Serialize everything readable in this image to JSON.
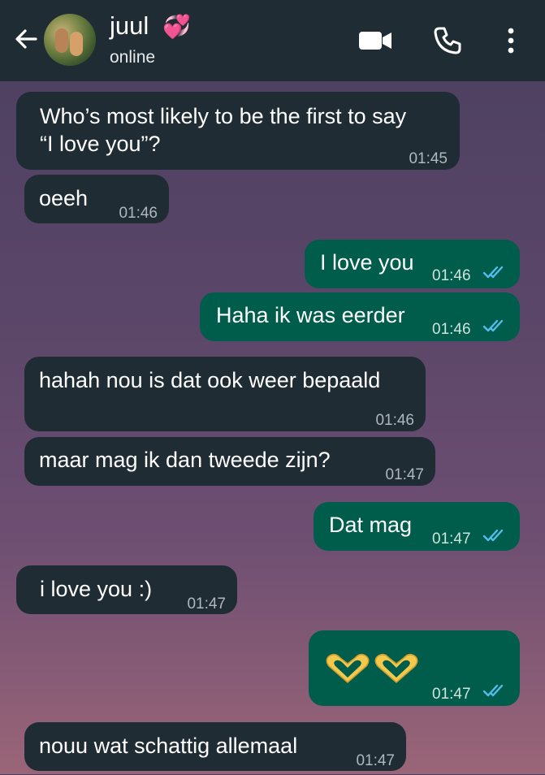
{
  "header": {
    "contact_name": "juul",
    "status": "online"
  },
  "messages": [
    {
      "dir": "in",
      "lines": [
        "Who’s most likely to be the first to say",
        "“I love you”?"
      ],
      "time": "01:45"
    },
    {
      "dir": "in",
      "text": "oeeh",
      "time": "01:46"
    },
    {
      "dir": "out",
      "text": "I love you",
      "time": "01:46",
      "read": true
    },
    {
      "dir": "out",
      "text": "Haha ik was eerder",
      "time": "01:46",
      "read": true
    },
    {
      "dir": "in",
      "text": "hahah nou is dat ook weer bepaald",
      "time": "01:46"
    },
    {
      "dir": "in",
      "text": "maar mag ik dan tweede zijn?",
      "time": "01:47"
    },
    {
      "dir": "out",
      "text": "Dat mag",
      "time": "01:47",
      "read": true
    },
    {
      "dir": "in",
      "text": "i love you :)",
      "time": "01:47"
    },
    {
      "dir": "out",
      "emoji": "heart-hands-icon x2",
      "time": "01:47",
      "read": true
    },
    {
      "dir": "in",
      "text": "nouu wat schattig allemaal",
      "time": "01:47"
    }
  ],
  "colors": {
    "header_bg": "#1f2c33",
    "incoming_bg": "#1f2c33",
    "outgoing_bg": "#005c4b",
    "read_ticks": "#53bdeb"
  }
}
